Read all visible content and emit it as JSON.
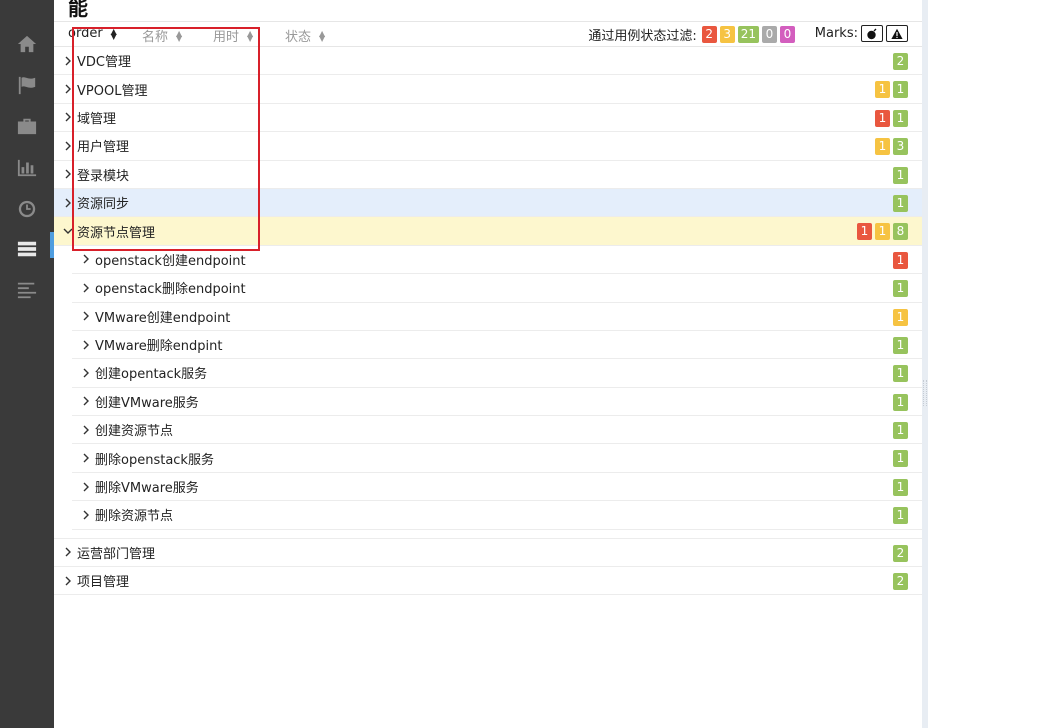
{
  "page_title": "能",
  "columns": [
    {
      "label": "order"
    },
    {
      "label": "名称"
    },
    {
      "label": "用时"
    },
    {
      "label": "状态"
    }
  ],
  "filter": {
    "label": "通过用例状态过滤:",
    "counts": [
      {
        "value": "2",
        "color": "#e9573f"
      },
      {
        "value": "3",
        "color": "#f6c342"
      },
      {
        "value": "21",
        "color": "#97c35d"
      },
      {
        "value": "0",
        "color": "#aaaaaa"
      },
      {
        "value": "0",
        "color": "#d35ebe"
      }
    ]
  },
  "marks": {
    "label": "Marks:"
  },
  "sidebar": {
    "items": [
      "home-icon",
      "flag-icon",
      "briefcase-icon",
      "bar-chart-icon",
      "clock-icon",
      "list-icon",
      "align-left-icon"
    ],
    "active": "list-icon"
  },
  "suites": [
    {
      "name": "VDC管理",
      "badges": [
        {
          "v": "2",
          "c": "green"
        }
      ]
    },
    {
      "name": "VPOOL管理",
      "badges": [
        {
          "v": "1",
          "c": "yellow"
        },
        {
          "v": "1",
          "c": "green"
        }
      ]
    },
    {
      "name": "域管理",
      "badges": [
        {
          "v": "1",
          "c": "red"
        },
        {
          "v": "1",
          "c": "green"
        }
      ]
    },
    {
      "name": "用户管理",
      "badges": [
        {
          "v": "1",
          "c": "yellow"
        },
        {
          "v": "3",
          "c": "green"
        }
      ]
    },
    {
      "name": "登录模块",
      "badges": [
        {
          "v": "1",
          "c": "green"
        }
      ]
    },
    {
      "name": "资源同步",
      "badges": [
        {
          "v": "1",
          "c": "green"
        }
      ]
    },
    {
      "name": "资源节点管理",
      "badges": [
        {
          "v": "1",
          "c": "red"
        },
        {
          "v": "1",
          "c": "yellow"
        },
        {
          "v": "8",
          "c": "green"
        }
      ],
      "children": [
        {
          "name": "openstack创建endpoint",
          "badges": [
            {
              "v": "1",
              "c": "red"
            }
          ]
        },
        {
          "name": "openstack删除endpoint",
          "badges": [
            {
              "v": "1",
              "c": "green"
            }
          ]
        },
        {
          "name": "VMware创建endpoint",
          "badges": [
            {
              "v": "1",
              "c": "yellow"
            }
          ]
        },
        {
          "name": "VMware删除endpint",
          "badges": [
            {
              "v": "1",
              "c": "green"
            }
          ]
        },
        {
          "name": "创建opentack服务",
          "badges": [
            {
              "v": "1",
              "c": "green"
            }
          ]
        },
        {
          "name": "创建VMware服务",
          "badges": [
            {
              "v": "1",
              "c": "green"
            }
          ]
        },
        {
          "name": "创建资源节点",
          "badges": [
            {
              "v": "1",
              "c": "green"
            }
          ]
        },
        {
          "name": "删除openstack服务",
          "badges": [
            {
              "v": "1",
              "c": "green"
            }
          ]
        },
        {
          "name": "删除VMware服务",
          "badges": [
            {
              "v": "1",
              "c": "green"
            }
          ]
        },
        {
          "name": "删除资源节点",
          "badges": [
            {
              "v": "1",
              "c": "green"
            }
          ]
        }
      ]
    },
    {
      "name": "运营部门管理",
      "badges": [
        {
          "v": "2",
          "c": "green"
        }
      ]
    },
    {
      "name": "项目管理",
      "badges": [
        {
          "v": "2",
          "c": "green"
        }
      ]
    }
  ]
}
